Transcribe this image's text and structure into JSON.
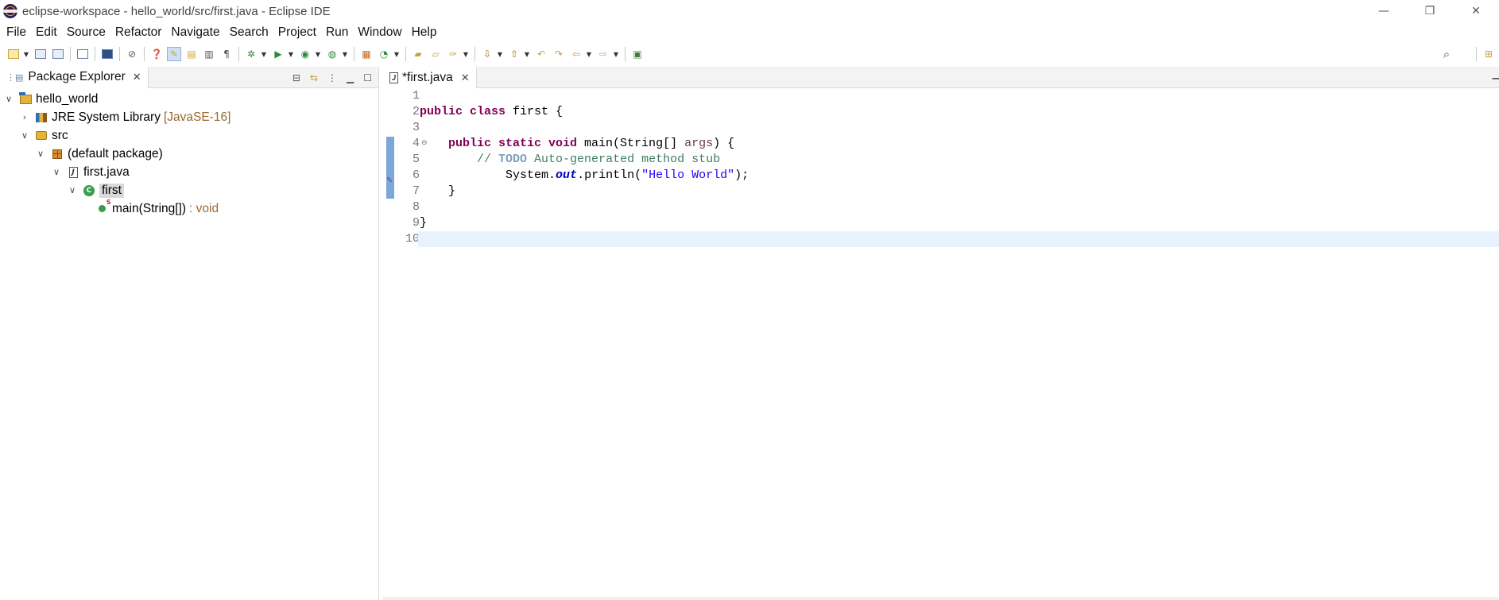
{
  "window": {
    "title": "eclipse-workspace - hello_world/src/first.java - Eclipse IDE",
    "controls": {
      "minimize": "—",
      "restore": "❐",
      "close": "✕"
    }
  },
  "menu": [
    "File",
    "Edit",
    "Source",
    "Refactor",
    "Navigate",
    "Search",
    "Project",
    "Run",
    "Window",
    "Help"
  ],
  "package_explorer": {
    "tab_label": "Package Explorer",
    "close_glyph": "✕",
    "tree": {
      "project": "hello_world",
      "library": "JRE System Library",
      "library_version": "[JavaSE-16]",
      "src": "src",
      "package": "(default package)",
      "file": "first.java",
      "class": "first",
      "method": "main(String[])",
      "method_return": ": void"
    }
  },
  "editor": {
    "tab_label": "*first.java",
    "close_glyph": "✕",
    "line_numbers": [
      "1",
      "2",
      "3",
      "4",
      "5",
      "6",
      "7",
      "8",
      "9",
      "10"
    ],
    "code": {
      "l2_kw": "public class",
      "l2_rest": " first {",
      "l4_indent": "    ",
      "l4_kw": "public static void",
      "l4_mid": " main(String[] ",
      "l4_param": "args",
      "l4_end": ") {",
      "l5_indent": "        ",
      "l5_slashes": "// ",
      "l5_todo": "TODO",
      "l5_rest": " Auto-generated method stub",
      "l6_indent": "            ",
      "l6_a": "System.",
      "l6_field": "out",
      "l6_b": ".println(",
      "l6_str": "\"Hello World\"",
      "l6_c": ");",
      "l7": "    }",
      "l9": "}"
    },
    "current_line": "10"
  },
  "icons": {
    "search": "search-icon",
    "open_perspective": "open-perspective-icon"
  }
}
